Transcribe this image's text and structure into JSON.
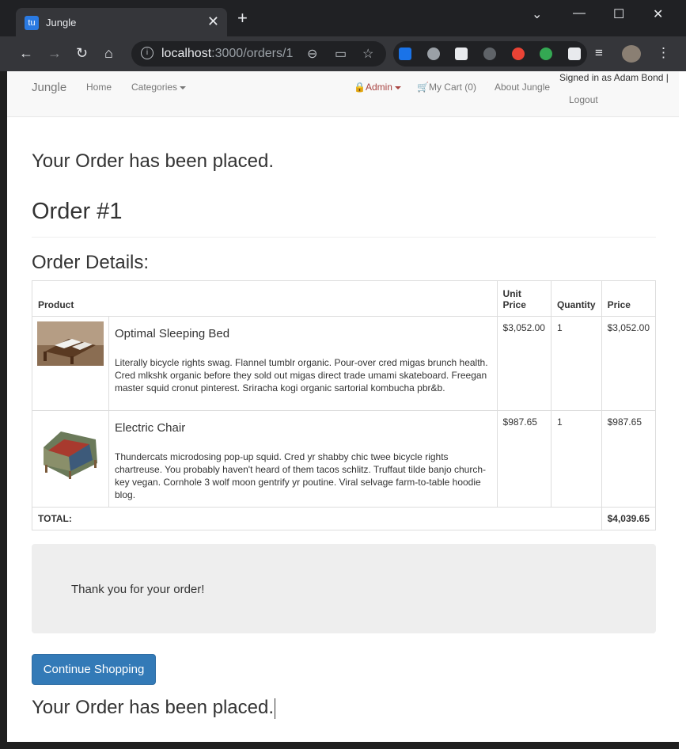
{
  "browser": {
    "tab_title": "Jungle",
    "tab_favicon_text": "tu",
    "url_host": "localhost",
    "url_path": ":3000/orders/1"
  },
  "navbar": {
    "brand": "Jungle",
    "home": "Home",
    "categories": "Categories",
    "admin": "Admin",
    "cart": "My Cart (0)",
    "about": "About Jungle",
    "signed_in": "Signed in as Adam Bond |",
    "logout": "Logout"
  },
  "main": {
    "heading_placed": "Your Order has been placed.",
    "order_title": "Order #1",
    "details_title": "Order Details:",
    "table": {
      "headers": {
        "product": "Product",
        "unit_price": "Unit Price",
        "quantity": "Quantity",
        "price": "Price"
      },
      "rows": [
        {
          "name": "Optimal Sleeping Bed",
          "description": "Literally bicycle rights swag. Flannel tumblr organic. Pour-over cred migas brunch health. Cred mlkshk organic before they sold out migas direct trade umami skateboard. Freegan master squid cronut pinterest. Sriracha kogi organic sartorial kombucha pbr&b.",
          "unit_price": "$3,052.00",
          "quantity": "1",
          "price": "$3,052.00"
        },
        {
          "name": "Electric Chair",
          "description": "Thundercats microdosing pop-up squid. Cred yr shabby chic twee bicycle rights chartreuse. You probably haven't heard of them tacos schlitz. Truffaut tilde banjo church-key vegan. Cornhole 3 wolf moon gentrify yr poutine. Viral selvage farm-to-table hoodie blog.",
          "unit_price": "$987.65",
          "quantity": "1",
          "price": "$987.65"
        }
      ],
      "total_label": "TOTAL:",
      "total_value": "$4,039.65"
    },
    "thank_you": "Thank you for your order!",
    "continue_button": "Continue Shopping",
    "heading_placed_bottom": "Your Order has been placed."
  }
}
